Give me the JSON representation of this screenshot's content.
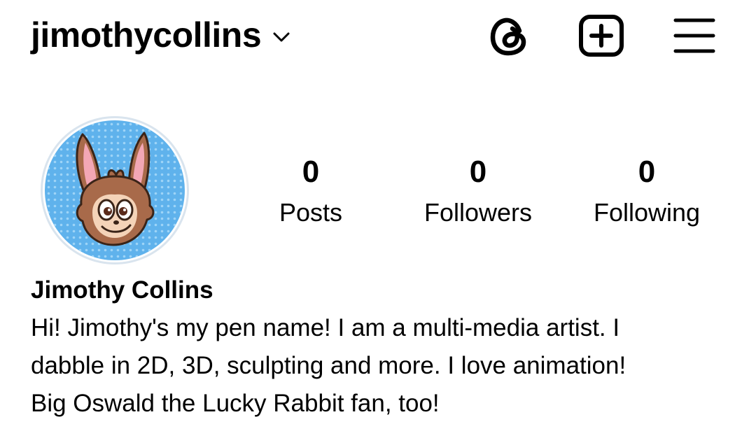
{
  "header": {
    "username": "jimothycollins",
    "icons": [
      "chevron-down-icon",
      "threads-icon",
      "create-post-icon",
      "menu-icon"
    ]
  },
  "profile": {
    "avatar_icon": "rabbit-character-avatar",
    "stats": {
      "posts": {
        "count": "0",
        "label": "Posts"
      },
      "followers": {
        "count": "0",
        "label": "Followers"
      },
      "following": {
        "count": "0",
        "label": "Following"
      }
    },
    "display_name": "Jimothy Collins",
    "bio_lines": [
      "Hi! Jimothy's my pen name! I am a multi-media artist. I",
      "dabble in 2D, 3D, sculpting and more. I love animation!",
      "Big Oswald the Lucky Rabbit fan, too!"
    ]
  },
  "colors": {
    "text": "#000000",
    "background": "#ffffff",
    "avatar_bg": "#5fb2ec",
    "avatar_border": "#d9e4ee"
  }
}
